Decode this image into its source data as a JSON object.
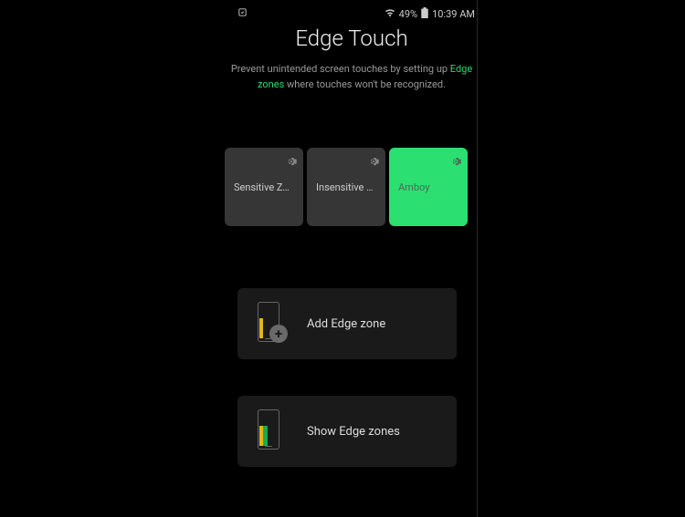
{
  "status": {
    "battery_pct": "49%",
    "time": "10:39 AM"
  },
  "header": {
    "title": "Edge Touch",
    "subtitle_pre": "Prevent unintended screen touches by setting up ",
    "subtitle_highlight": "Edge zones",
    "subtitle_post": " where touches won't be recognized."
  },
  "zones": [
    {
      "label": "Sensitive Zone",
      "active": false
    },
    {
      "label": "Insensitive Z…",
      "active": false
    },
    {
      "label": "Amboy",
      "active": true
    }
  ],
  "actions": {
    "add": "Add Edge zone",
    "show": "Show Edge zones"
  }
}
